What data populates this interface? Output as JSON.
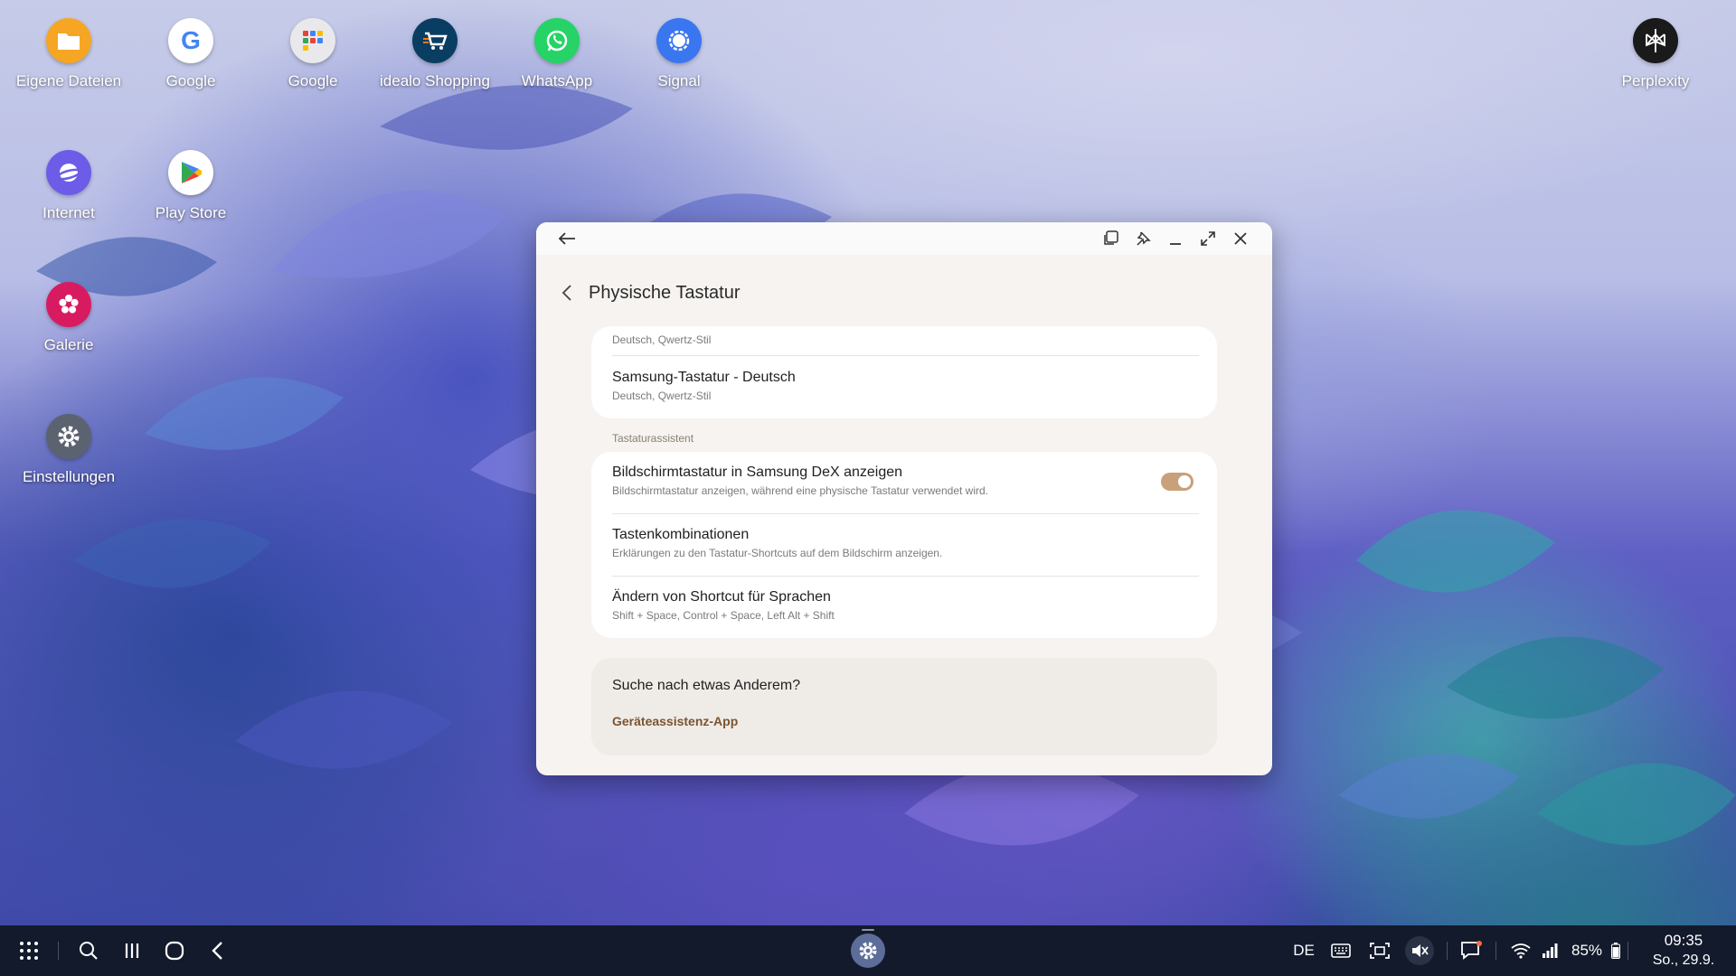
{
  "desktop": {
    "icons": [
      {
        "label": "Eigene Dateien",
        "icon": "folder-icon",
        "color": "#f6a623"
      },
      {
        "label": "Google",
        "icon": "google-icon",
        "color": "#ffffff"
      },
      {
        "label": "Google",
        "icon": "google-folder-icon",
        "color": "#e9e9ec"
      },
      {
        "label": "idealo Shopping",
        "icon": "idealo-icon",
        "color": "#0a3d62"
      },
      {
        "label": "WhatsApp",
        "icon": "whatsapp-icon",
        "color": "#25d366"
      },
      {
        "label": "Signal",
        "icon": "signal-icon",
        "color": "#3a76f0"
      },
      {
        "label": "Perplexity",
        "icon": "perplexity-icon",
        "color": "#1a1a1a"
      },
      {
        "label": "Internet",
        "icon": "internet-icon",
        "color": "#6c5ce7"
      },
      {
        "label": "Play Store",
        "icon": "play-store-icon",
        "color": "#ffffff"
      },
      {
        "label": "Galerie",
        "icon": "gallery-icon",
        "color": "#d81b60"
      },
      {
        "label": "Einstellungen",
        "icon": "settings-icon",
        "color": "#5c6370"
      }
    ]
  },
  "window": {
    "title": "Physische Tastatur",
    "keyboard_card": {
      "top_subtitle": "Deutsch, Qwertz-Stil",
      "item_title": "Samsung-Tastatur - Deutsch",
      "item_subtitle": "Deutsch, Qwertz-Stil"
    },
    "assistant_section_label": "Tastaturassistent",
    "assistant_items": [
      {
        "title": "Bildschirmtastatur in Samsung DeX anzeigen",
        "subtitle": "Bildschirmtastatur anzeigen, während eine physische Tastatur verwendet wird.",
        "toggle_on": true
      },
      {
        "title": "Tastenkombinationen",
        "subtitle": "Erklärungen zu den Tastatur-Shortcuts auf dem Bildschirm anzeigen."
      },
      {
        "title": "Ändern von Shortcut für Sprachen",
        "subtitle": "Shift + Space, Control + Space, Left Alt + Shift"
      }
    ],
    "help": {
      "question": "Suche nach etwas Anderem?",
      "link": "Geräteassistenz-App"
    },
    "accent_color": "#c8a07a",
    "link_color": "#7a5430"
  },
  "taskbar": {
    "language": "DE",
    "battery": "85%",
    "time": "09:35",
    "date": "So., 29.9."
  }
}
